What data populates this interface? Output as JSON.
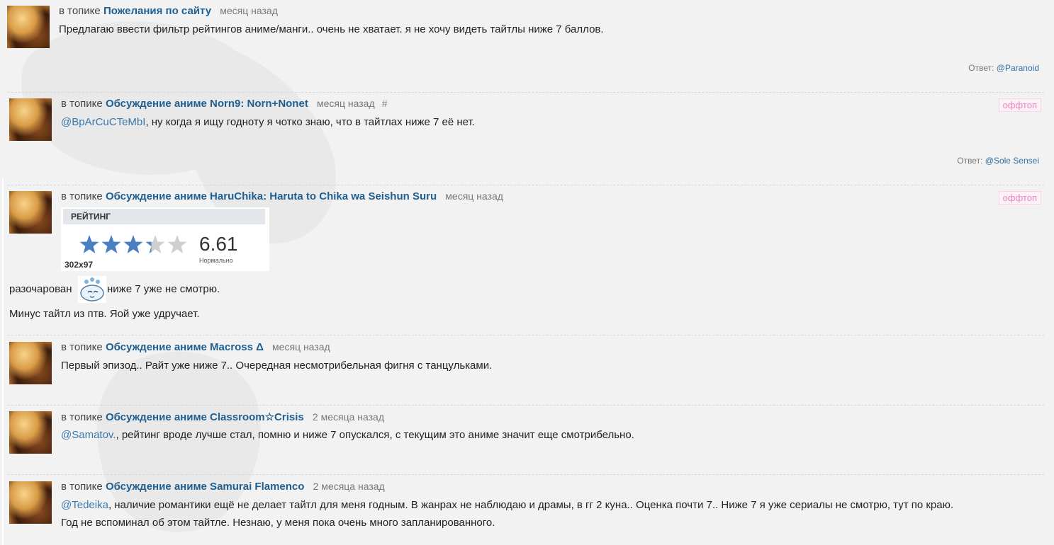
{
  "comments": [
    {
      "prefix": "в топике",
      "topic": "Пожелания по сайту",
      "time": "месяц назад",
      "text": "Предлагаю ввести фильтр рейтингов аниме/манги.. очень не хватает. я не хочу видеть тайтлы ниже 7 баллов.",
      "reply_label": "Ответ:",
      "reply_user": "@Paranoid"
    },
    {
      "prefix": "в топике",
      "topic": "Обсуждение аниме Norn9: Norn+Nonet",
      "time": "месяц назад",
      "hash": "#",
      "tag": "оффтоп",
      "mention": "@BpArCuCTeMbI",
      "text": ", ну когда я ищу годноту я чотко знаю, что в тайтлах ниже 7 её нет.",
      "reply_label": "Ответ:",
      "reply_user": "@Sole Sensei"
    },
    {
      "prefix": "в топике",
      "topic": "Обсуждение аниме HaruChika: Haruta to Chika wa Seishun Suru",
      "time": "месяц назад",
      "tag": "оффтоп",
      "rating_card": {
        "title": "РЕЙТИНГ",
        "score": "6.61",
        "score_label": "Нормально",
        "dimensions": "302x97",
        "stars": 3.3
      },
      "text_before_emoji": "разочарован",
      "text_after_emoji": "ниже 7 уже не смотрю.",
      "text2": "Минус тайтл из птв. Яой уже удручает."
    },
    {
      "prefix": "в топике",
      "topic": "Обсуждение аниме Macross Δ",
      "time": "месяц назад",
      "text": "Первый эпизод.. Райт уже ниже 7.. Очередная несмотрибельная фигня с танцульками."
    },
    {
      "prefix": "в топике",
      "topic": "Обсуждение аниме Classroom☆Crisis",
      "time": "2 месяца назад",
      "mention": "@Samatov.",
      "text": ", рейтинг вроде лучше стал, помню и ниже 7 опускался, с текущим это аниме значит еще смотрибельно."
    },
    {
      "prefix": "в топике",
      "topic": "Обсуждение аниме Samurai Flamenco",
      "time": "2 месяца назад",
      "mention": "@Tedeika",
      "text": ", наличие романтики ещё не делает тайтл для меня годным. В жанрах не наблюдаю и драмы, в гг 2 куна.. Оценка почти 7.. Ниже 7 я уже сериалы не смотрю, тут по краю.",
      "text2": "Год не вспоминал об этом тайтле. Незнаю, у меня пока очень много запланированного."
    }
  ],
  "colors": {
    "link": "#1f5f91",
    "mention": "#3a78ad",
    "offtop": "#e787c2",
    "star_filled": "#4a7fc1",
    "star_empty": "#cfcfcf"
  }
}
